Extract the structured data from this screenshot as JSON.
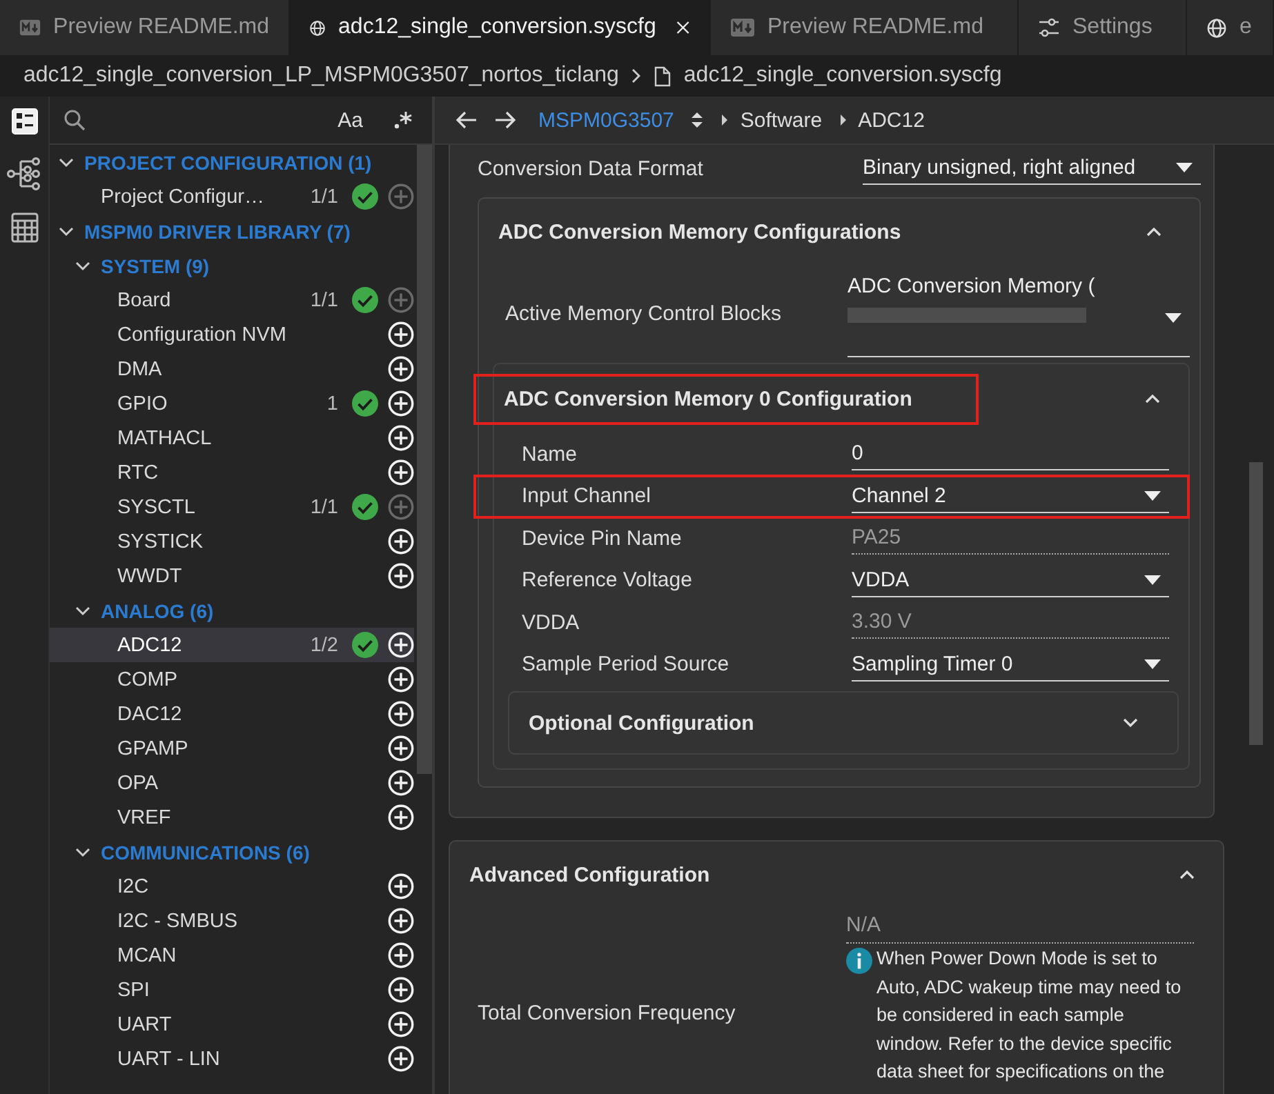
{
  "tabs": [
    {
      "label": "Preview README.md",
      "kind": "markdown",
      "selected": false,
      "closable": false
    },
    {
      "label": "adc12_single_conversion.syscfg",
      "kind": "globe",
      "selected": true,
      "closable": true
    },
    {
      "label": "Preview README.md",
      "kind": "markdown",
      "selected": false,
      "closable": false
    },
    {
      "label": "Settings",
      "kind": "settings",
      "selected": false,
      "closable": false
    },
    {
      "label": "e",
      "kind": "globe",
      "selected": false,
      "closable": false
    }
  ],
  "breadcrumb": [
    {
      "label": "adc12_single_conversion_LP_MSPM0G3507_nortos_ticlang",
      "kind": "folder"
    },
    {
      "label": "adc12_single_conversion.syscfg",
      "kind": "file"
    }
  ],
  "activity_bar": [
    {
      "kind": "list",
      "selected": true
    },
    {
      "kind": "tree",
      "selected": false
    },
    {
      "kind": "calculator",
      "selected": false
    }
  ],
  "search": {
    "match_case": "Aa"
  },
  "tree": [
    {
      "kind": "group",
      "label": "PROJECT CONFIGURATION (1)",
      "expanded": true,
      "children": [
        {
          "kind": "module",
          "label": "Project Configur…",
          "count": "1/1",
          "added": true,
          "can_add": false,
          "selected": false
        }
      ]
    },
    {
      "kind": "group",
      "label": "MSPM0 DRIVER LIBRARY (7)",
      "expanded": true,
      "children": [
        {
          "kind": "group",
          "label": "SYSTEM (9)",
          "expanded": true,
          "children": [
            {
              "kind": "module",
              "label": "Board",
              "count": "1/1",
              "added": true,
              "can_add": false,
              "selected": false
            },
            {
              "kind": "module",
              "label": "Configuration NVM",
              "added": false,
              "can_add": true,
              "selected": false
            },
            {
              "kind": "module",
              "label": "DMA",
              "added": false,
              "can_add": true,
              "selected": false
            },
            {
              "kind": "module",
              "label": "GPIO",
              "count": "1",
              "added": true,
              "can_add": true,
              "selected": false
            },
            {
              "kind": "module",
              "label": "MATHACL",
              "added": false,
              "can_add": true,
              "selected": false
            },
            {
              "kind": "module",
              "label": "RTC",
              "added": false,
              "can_add": true,
              "selected": false
            },
            {
              "kind": "module",
              "label": "SYSCTL",
              "count": "1/1",
              "added": true,
              "can_add": false,
              "selected": false
            },
            {
              "kind": "module",
              "label": "SYSTICK",
              "added": false,
              "can_add": true,
              "selected": false
            },
            {
              "kind": "module",
              "label": "WWDT",
              "added": false,
              "can_add": true,
              "selected": false
            }
          ]
        },
        {
          "kind": "group",
          "label": "ANALOG (6)",
          "expanded": true,
          "children": [
            {
              "kind": "module",
              "label": "ADC12",
              "count": "1/2",
              "added": true,
              "can_add": true,
              "selected": true
            },
            {
              "kind": "module",
              "label": "COMP",
              "added": false,
              "can_add": true,
              "selected": false
            },
            {
              "kind": "module",
              "label": "DAC12",
              "added": false,
              "can_add": true,
              "selected": false
            },
            {
              "kind": "module",
              "label": "GPAMP",
              "added": false,
              "can_add": true,
              "selected": false
            },
            {
              "kind": "module",
              "label": "OPA",
              "added": false,
              "can_add": true,
              "selected": false
            },
            {
              "kind": "module",
              "label": "VREF",
              "added": false,
              "can_add": true,
              "selected": false
            }
          ]
        },
        {
          "kind": "group",
          "label": "COMMUNICATIONS (6)",
          "expanded": true,
          "children": [
            {
              "kind": "module",
              "label": "I2C",
              "added": false,
              "can_add": true,
              "selected": false
            },
            {
              "kind": "module",
              "label": "I2C - SMBUS",
              "added": false,
              "can_add": true,
              "selected": false
            },
            {
              "kind": "module",
              "label": "MCAN",
              "added": false,
              "can_add": true,
              "selected": false
            },
            {
              "kind": "module",
              "label": "SPI",
              "added": false,
              "can_add": true,
              "selected": false
            },
            {
              "kind": "module",
              "label": "UART",
              "added": false,
              "can_add": true,
              "selected": false
            },
            {
              "kind": "module",
              "label": "UART - LIN",
              "added": false,
              "can_add": true,
              "selected": false
            }
          ]
        }
      ]
    }
  ],
  "nav": {
    "device": "MSPM0G3507",
    "path": [
      "Software",
      "ADC12"
    ]
  },
  "config": {
    "fields": [
      {
        "label": "Conversion Data Format",
        "value": "Binary unsigned, right aligned",
        "kind": "dropdown",
        "highlighted": false
      }
    ],
    "memory": {
      "title": "ADC Conversion Memory Configurations",
      "expanded": true,
      "active_blocks": {
        "label": "Active Memory Control Blocks",
        "value": "ADC Conversion Memory (",
        "kind": "multiselect"
      },
      "block": {
        "title": "ADC Conversion Memory 0 Configuration",
        "expanded": true,
        "highlighted": true,
        "fields": [
          {
            "label": "Name",
            "value": "0",
            "kind": "text",
            "highlighted": false
          },
          {
            "label": "Input Channel",
            "value": "Channel 2",
            "kind": "dropdown",
            "highlighted": true
          },
          {
            "label": "Device Pin Name",
            "value": "PA25",
            "kind": "readonly",
            "highlighted": false
          },
          {
            "label": "Reference Voltage",
            "value": "VDDA",
            "kind": "dropdown",
            "highlighted": false
          },
          {
            "label": "VDDA",
            "value": "3.30 V",
            "kind": "readonly",
            "highlighted": false
          },
          {
            "label": "Sample Period Source",
            "value": "Sampling Timer 0",
            "kind": "dropdown",
            "highlighted": false
          }
        ],
        "optional": {
          "title": "Optional Configuration",
          "expanded": false
        }
      }
    },
    "advanced": {
      "title": "Advanced Configuration",
      "expanded": true,
      "fields": [
        {
          "label": "Total Conversion Frequency",
          "value": "N/A",
          "kind": "readonly",
          "note": "When Power Down Mode is set to Auto, ADC wakeup time may need to be considered in each sample window. Refer to the device specific data sheet for specifications on the"
        }
      ]
    }
  }
}
